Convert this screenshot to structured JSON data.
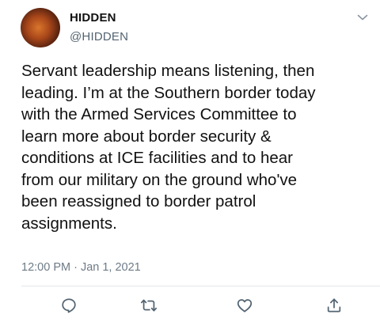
{
  "author": {
    "display_name": "HIDDEN",
    "handle": "@HIDDEN"
  },
  "tweet": {
    "text_lines": [
      "Servant leadership means listening, then",
      "leading. I’m at the Southern border today",
      "with the Armed Services Committee to",
      "learn more about border security &",
      "conditions at ICE facilities and to hear",
      "from our military on the ground who've",
      "been reassigned to border patrol",
      "assignments."
    ],
    "timestamp": "12:00 PM · Jan 1, 2021"
  },
  "icons": {
    "menu": "chevron-down-icon",
    "reply": "reply-icon",
    "retweet": "retweet-icon",
    "like": "like-icon",
    "share": "share-icon"
  },
  "colors": {
    "icon": "#536471",
    "secondary_text": "#536471",
    "divider": "#e3e6e8"
  }
}
